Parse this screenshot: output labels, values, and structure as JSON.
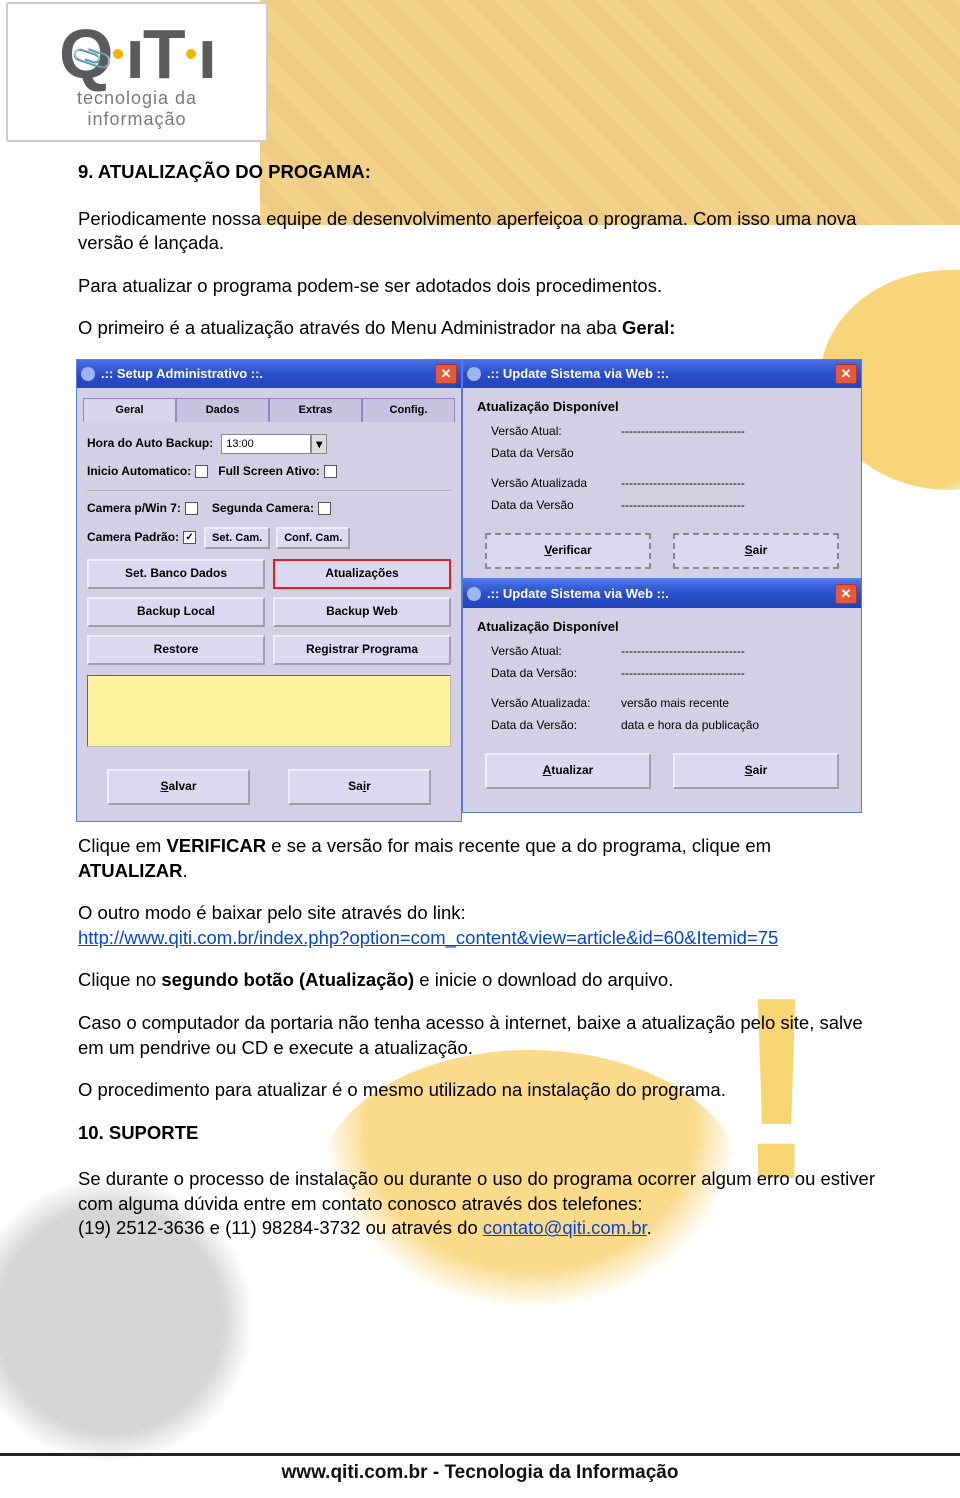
{
  "logo": {
    "brand": "QiTi",
    "sub1": "tecnologia da",
    "sub2": "informação"
  },
  "doc": {
    "h9": "9. ATUALIZAÇÃO DO PROGAMA:",
    "p1": "Periodicamente nossa equipe de desenvolvimento aperfeiçoa o programa. Com isso uma nova versão é lançada.",
    "p2": "Para atualizar o programa podem-se ser adotados dois procedimentos.",
    "p3a": "O primeiro é a atualização através do Menu Administrador na aba ",
    "p3b": "Geral:",
    "p4a": "Clique em ",
    "p4b": "VERIFICAR",
    "p4c": " e se a versão for mais recente que a do programa, clique em ",
    "p4d": "ATUALIZAR",
    "p4e": ".",
    "p5": "O outro modo é baixar pelo site através do link:",
    "link": "http://www.qiti.com.br/index.php?option=com_content&view=article&id=60&Itemid=75",
    "p6a": "Clique no ",
    "p6b": "segundo botão (Atualização)",
    "p6c": " e inicie o download do arquivo.",
    "p7": "Caso o computador da portaria não tenha acesso à internet, baixe a atualização pelo site, salve em um pendrive ou CD e execute a atualização.",
    "p8": "O procedimento para atualizar é o mesmo utilizado na instalação do programa.",
    "h10": "10. SUPORTE",
    "p9": "Se durante o processo de instalação ou durante o uso do programa ocorrer algum erro ou estiver com alguma dúvida entre em contato conosco através dos telefones:",
    "p10a": "(19) 2512-3636 e (11) 98284-3732 ou através do ",
    "p10b": "contato@qiti.com.br",
    "p10c": "."
  },
  "setup": {
    "title": ".:: Setup Administrativo ::.",
    "tabs": [
      "Geral",
      "Dados",
      "Extras",
      "Config."
    ],
    "hora_label": "Hora do Auto Backup:",
    "hora_value": "13:00",
    "inicio_label": "Inicio Automatico:",
    "full_label": "Full Screen Ativo:",
    "cam7_label": "Camera p/Win 7:",
    "seg_label": "Segunda Camera:",
    "padrao_label": "Camera Padrão:",
    "setcam": "Set. Cam.",
    "confcam": "Conf. Cam.",
    "buttons": {
      "banco": "Set. Banco Dados",
      "atual": "Atualizações",
      "blocal": "Backup Local",
      "bweb": "Backup Web",
      "restore": "Restore",
      "reg": "Registrar Programa"
    },
    "salvar": "Salvar",
    "sair": "Sair"
  },
  "update1": {
    "title": ".:: Update Sistema via Web ::.",
    "sec": "Atualização Disponível",
    "va": "Versão Atual:",
    "dv1": "Data da Versão",
    "vat": "Versão Atualizada",
    "dv2": "Data da Versão",
    "dash": "-------------------------------",
    "verificar": "Verificar",
    "sair": "Sair"
  },
  "update2": {
    "title": ".:: Update Sistema via Web ::.",
    "sec": "Atualização Disponível",
    "va": "Versão Atual:",
    "dv1": "Data da Versão:",
    "vat": "Versão Atualizada:",
    "vat_v": "versão mais recente",
    "dv2": "Data da Versão:",
    "dv2_v": "data e hora da publicação",
    "dash": "-------------------------------",
    "atualizar": "Atualizar",
    "sair": "Sair"
  },
  "footer": "www.qiti.com.br - Tecnologia da Informação"
}
